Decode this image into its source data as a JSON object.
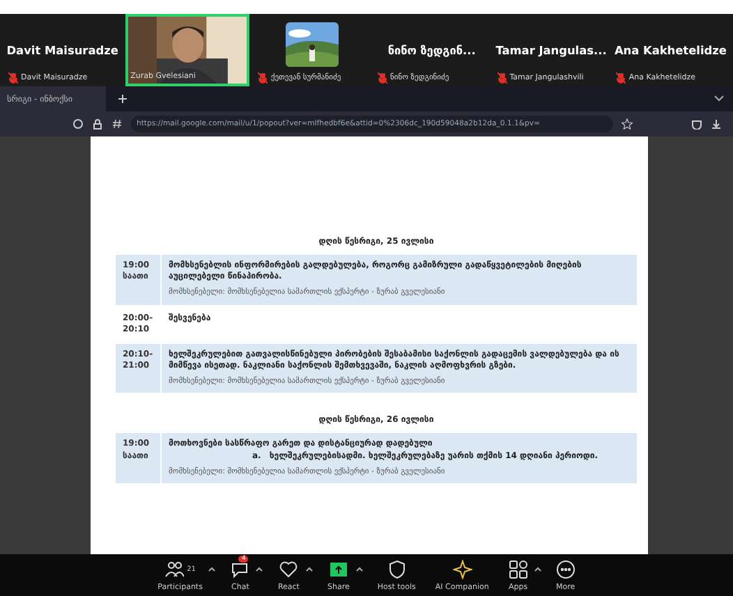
{
  "participants_strip": [
    {
      "kind": "name",
      "display_name": "Davit Maisuradze",
      "label": "Davit Maisuradze",
      "muted": true
    },
    {
      "kind": "video",
      "label": "Zurab Gvelesiani",
      "muted": false,
      "speaking": true
    },
    {
      "label": "ქეთევან სურმანიძე",
      "muted": true
    },
    {
      "kind": "name",
      "display_name": "ნინო ზედგინ...",
      "label": "ნინო ზედგინიძე",
      "muted": true
    },
    {
      "kind": "name",
      "display_name": "Tamar Jangulas...",
      "label": "Tamar Jangulashvili",
      "muted": true
    },
    {
      "kind": "name",
      "display_name": "Ana Kakhetelidze",
      "label": "Ana Kakhetelidze",
      "muted": true
    }
  ],
  "browser": {
    "tab": "სრიგი - ინბოქსი",
    "url": "https://mail.google.com/mail/u/1/popout?ver=mlfhedbf6e&attid=0%2306dc_190d59048a2b12da_0.1.1&pv="
  },
  "document": {
    "days": [
      {
        "heading": "დღის წესრიგი, 25 ივლისი",
        "rows": [
          {
            "time": "19:00 საათი",
            "highlighted": true,
            "title": "მომხსენებლის ინფორმირების გალდებულება, როგორც გამიზრული გადაწყვეტილების მიღების აუცილებელი წინაპირობა.",
            "speaker": "მომხსენებელი: მომხსენებელია სამართლის ექსპერტი - ზურაბ გველესიანი"
          },
          {
            "time": "20:00-20:10",
            "highlighted": false,
            "title": "შესვენება"
          },
          {
            "time": "20:10-21:00",
            "highlighted": true,
            "title": "ხელშეკრულებით გათვალისწინებული პირობების შესაბამისი საქონლის გადაცემის ვალდებულება და ის მიმწევა ისეთად. ნაკლიანი საქონლის შემთხვევაში, ნაკლის აღმოფხვრის გზები.",
            "speaker": "მომხსენებელი: მომხსენებელია სამართლის ექსპერტი - ზურაბ გველესიანი"
          }
        ]
      },
      {
        "heading": "დღის წესრიგი, 26 ივლისი",
        "rows": [
          {
            "time": "19:00 საათი",
            "highlighted": true,
            "title": "მოთხოვნები სასწრაფო გარეთ და დისტანციურად დადებული",
            "item_marker": "a.",
            "item": "ხელშეკრულებისადმი. ხელშეკრულებაზე უარის თქმის 14 დღიანი პერიოდი.",
            "speaker": "მომხსენებელი: მომხსენებელია სამართლის ექსპერტი - ზურაბ გველესიანი"
          }
        ]
      }
    ]
  },
  "toolbar": [
    {
      "kind": "participants",
      "label": "Participants",
      "count": "21",
      "caret": true
    },
    {
      "kind": "chat",
      "label": "Chat",
      "badge": "4",
      "caret": true
    },
    {
      "kind": "react",
      "label": "React",
      "caret": true
    },
    {
      "kind": "share",
      "label": "Share",
      "caret": true
    },
    {
      "kind": "host",
      "label": "Host tools",
      "caret": false
    },
    {
      "kind": "ai",
      "label": "AI Companion",
      "caret": false
    },
    {
      "kind": "apps",
      "label": "Apps",
      "caret": true
    },
    {
      "kind": "more",
      "label": "More",
      "caret": false
    }
  ]
}
